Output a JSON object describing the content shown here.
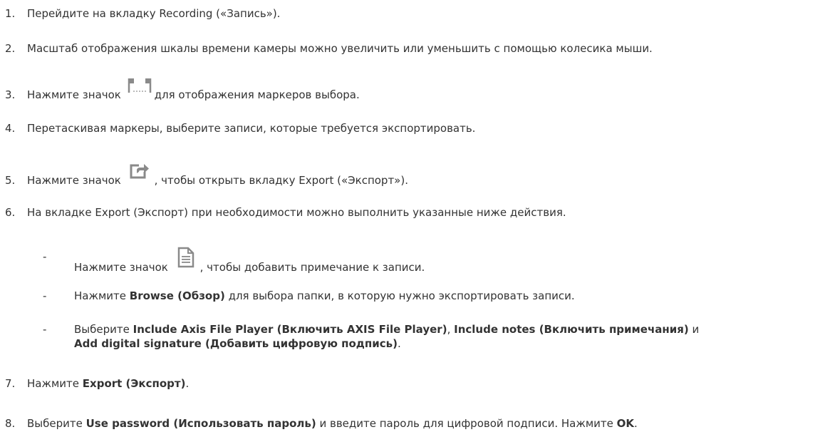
{
  "steps": [
    {
      "num": "1.",
      "text": "Перейдите на вкладку Recording («Запись»)."
    },
    {
      "num": "2.",
      "text": "Масштаб отображения шкалы времени камеры можно увеличить или уменьшить с помощью колесика мыши."
    },
    {
      "num": "3.",
      "pre": "Нажмите значок",
      "post": "для отображения маркеров выбора.",
      "icon": "selection-markers-icon"
    },
    {
      "num": "4.",
      "text": "Перетаскивая маркеры, выберите записи, которые требуется экспортировать."
    },
    {
      "num": "5.",
      "pre": "Нажмите значок",
      "post": ", чтобы открыть вкладку Export («Экспорт»).",
      "icon": "export-icon"
    },
    {
      "num": "6.",
      "text": "На вкладке Export (Экспорт) при необходимости можно выполнить указанные ниже действия."
    },
    {
      "num": "7.",
      "pre": "Нажмите ",
      "bold": "Export (Экспорт)",
      "post": "."
    },
    {
      "num": "8.",
      "pre": "Выберите ",
      "bold1": "Use password (Использовать пароль)",
      "mid": " и введите пароль для цифровой подписи. Нажмите ",
      "bold2": "OK",
      "post": "."
    }
  ],
  "substeps": [
    {
      "dash": "-",
      "pre": "Нажмите значок",
      "post": ", чтобы добавить примечание к записи.",
      "icon": "document-icon"
    },
    {
      "dash": "-",
      "pre": "Нажмите ",
      "bold": "Browse (Обзор)",
      "post": " для выбора папки, в которую нужно экспортировать записи."
    },
    {
      "dash": "-",
      "pre": "Выберите ",
      "bold1": "Include Axis File Player (Включить AXIS File Player)",
      "mid1": ", ",
      "bold2": "Include notes (Включить примечания)",
      "mid2": " и",
      "bold3": "Add digital signature (Добавить цифровую подпись)",
      "post": "."
    }
  ]
}
